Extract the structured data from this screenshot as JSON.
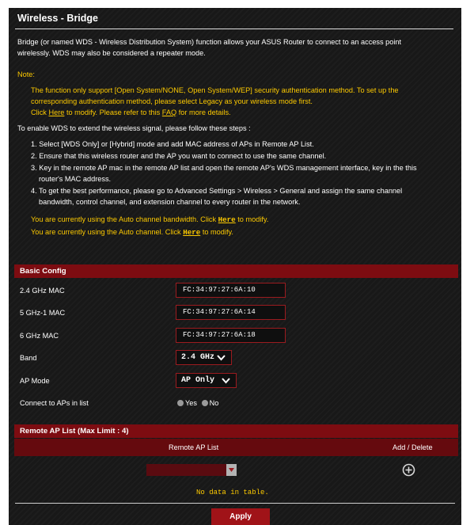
{
  "header": {
    "title": "Wireless - Bridge"
  },
  "intro": {
    "line1": "Bridge (or named WDS - Wireless Distribution System) function allows your ASUS Router to connect to an access point",
    "line2": "wirelessly. WDS may also be considered a repeater mode."
  },
  "note": {
    "label": "Note:",
    "line1": "The function only support [Open System/NONE, Open System/WEP] security authentication method. To set up the",
    "line2": "corresponding authentication method, please select Legacy as your wireless mode first.",
    "line3_prefix": "Click ",
    "here_link": "Here",
    "line3_mid": " to modify. Please refer to this ",
    "faq_link": "FAQ",
    "line3_suffix": " for more details."
  },
  "steps": {
    "intro": "To enable WDS to extend the wireless signal, please follow these steps :",
    "s1": "1. Select [WDS Only] or [Hybrid] mode and add MAC address of APs in Remote AP List.",
    "s2": "2. Ensure that this wireless router and the AP you want to connect to use the same channel.",
    "s3a": "3. Key in the remote AP mac in the remote AP list and open the remote AP's WDS management interface, key in the this",
    "s3b": "router's MAC address.",
    "s4a": "4. To get the best performance, please go to Advanced Settings > Wireless > General and assign the same channel",
    "s4b": "bandwidth, control channel, and extension channel to every router in the network."
  },
  "notices": {
    "bw_prefix": "You are currently using the Auto channel bandwidth. Click ",
    "bw_link": "Here",
    "bw_suffix": " to modify.",
    "ch_prefix": "You are currently using the Auto channel. Click ",
    "ch_link": "Here",
    "ch_suffix": " to modify."
  },
  "basic_config": {
    "header": "Basic Config",
    "mac_24_label": "2.4 GHz MAC",
    "mac_24_value": "FC:34:97:27:6A:10",
    "mac_5g1_label": "5 GHz-1 MAC",
    "mac_5g1_value": "FC:34:97:27:6A:14",
    "mac_6g_label": "6 GHz MAC",
    "mac_6g_value": "FC:34:97:27:6A:18",
    "band_label": "Band",
    "band_value": "2.4 GHz",
    "ap_mode_label": "AP Mode",
    "ap_mode_value": "AP Only",
    "connect_label": "Connect to APs in list",
    "yes_label": "Yes",
    "no_label": "No"
  },
  "remote_ap": {
    "header": "Remote AP List (Max Limit : 4)",
    "col_ap": "Remote AP List",
    "col_action": "Add / Delete",
    "empty_text": "No data in table."
  },
  "footer": {
    "apply_label": "Apply"
  },
  "colors": {
    "background": "#181818",
    "accent_red": "#7d0c11",
    "button_red": "#a01318",
    "note_yellow": "#fcc900",
    "text": "#ffffff"
  }
}
